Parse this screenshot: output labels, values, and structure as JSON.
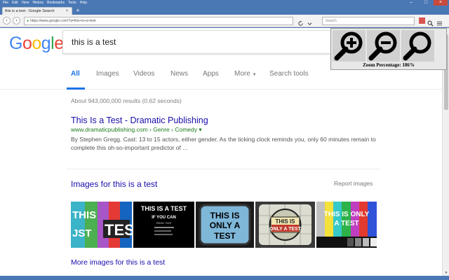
{
  "window": {
    "menu": [
      "File",
      "Edit",
      "View",
      "History",
      "Bookmarks",
      "Tools",
      "Help"
    ],
    "controls": {
      "minimize": "–",
      "maximize": "□",
      "close": "×"
    }
  },
  "tab": {
    "title": "this is a test - Google Search",
    "close": "×",
    "new": "+"
  },
  "nav": {
    "back": "‹",
    "forward": "›",
    "url": "https://www.google.com/?q=this+is+a+test",
    "search_placeholder": "Search"
  },
  "logo": {
    "letters": [
      "G",
      "o",
      "o",
      "g",
      "l",
      "e"
    ]
  },
  "search": {
    "query": "this is a test"
  },
  "tabs": [
    {
      "label": "All",
      "active": true
    },
    {
      "label": "Images"
    },
    {
      "label": "Videos"
    },
    {
      "label": "News"
    },
    {
      "label": "Apps"
    },
    {
      "label": "More"
    },
    {
      "label": "Search tools"
    }
  ],
  "stats": "About 943,000,000 results (0.62 seconds)",
  "result": {
    "title": "This Is a Test - Dramatic Publishing",
    "url": "www.dramaticpublishing.com › Genre › Comedy ▾",
    "snippet": "By Stephen Gregg. Cast: 13 to 15 actors, either gender. As the ticking clock reminds you, only 60 minutes remain to complete this oh-so-important predictor of ..."
  },
  "images": {
    "header": "Images for this is a test",
    "report": "Report images",
    "more": "More images for this is a test",
    "thumbs": [
      {
        "lines": [
          "THIS",
          "JST",
          "TES"
        ]
      },
      {
        "lines": [
          "THIS IS A TEST",
          "IF YOU CAN",
          "READ THIS"
        ]
      },
      {
        "lines": [
          "THIS IS",
          "ONLY A",
          "TEST"
        ]
      },
      {
        "lines": [
          "THIS IS",
          "ONLY A TEST"
        ]
      },
      {
        "lines": [
          "THIS IS ONLY",
          "A TEST"
        ]
      }
    ]
  },
  "zoom": {
    "label": "Zoom Percentage: 186%",
    "buttons": [
      "zoom-in",
      "zoom-out",
      "zoom-reset"
    ]
  },
  "colors": {
    "link": "#1a0dab",
    "url_green": "#1e7a1e",
    "active_tab": "#1a73e8",
    "chrome": "#4a78b5"
  }
}
